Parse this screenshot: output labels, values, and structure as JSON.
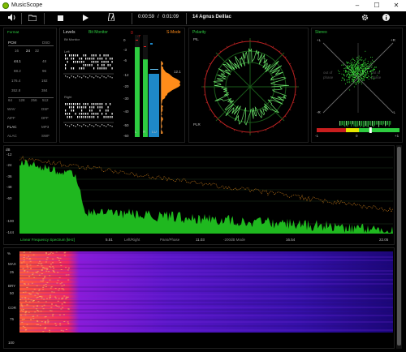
{
  "app": {
    "title": "MusicScope",
    "window_controls": [
      "–",
      "☐",
      "✕"
    ]
  },
  "toolbar": {
    "elapsed": "0:00:59",
    "total": "0:01:09",
    "track": "14 Agnus DeiIlac",
    "icons": [
      "volume-icon",
      "folder-icon",
      "stop-icon",
      "play-icon",
      "metronome-icon",
      "gear-icon",
      "info-icon"
    ]
  },
  "format": {
    "title": "Format",
    "formats": [
      {
        "label": "PCM",
        "selected": true
      },
      {
        "label": "DSD",
        "selected": false
      }
    ],
    "bitdepths": [
      "16",
      "24",
      "32"
    ],
    "bitdepth_selected": "24",
    "rates": [
      [
        "44.1",
        "48"
      ],
      [
        "88.2",
        "96"
      ],
      [
        "176.4",
        "192"
      ],
      [
        "352.8",
        "384"
      ]
    ],
    "rate_selected": "44.1",
    "bits_row": [
      "64",
      "128",
      "256",
      "512"
    ],
    "types": [
      [
        "WAV",
        "DSF"
      ],
      [
        "AIFF",
        "DFF"
      ],
      [
        "FLAC",
        "MP3"
      ],
      [
        "ALAC",
        "SWF"
      ]
    ],
    "type_selected": "FLAC"
  },
  "levels": {
    "title": "Levels",
    "bitmon": "Bit Monitor",
    "bitmon_label": "Bit Monitor",
    "left": "Left",
    "right": "Right",
    "scale": [
      "0",
      "-3",
      "-6",
      "-12",
      "-20",
      "-30",
      "-40",
      "-50",
      "-60"
    ],
    "peak_left": "-7",
    "peak_right": "-12",
    "smode": "S-Mode",
    "reading": "12.1",
    "lu": "LU",
    "ch": [
      "L",
      "R"
    ],
    "meter_left": 0.88,
    "meter_right": 0.76
  },
  "polar": {
    "title": "Polarity",
    "top": "PIL",
    "bottom": "PLR"
  },
  "stereo": {
    "title": "Stereo",
    "l_plus": "+L",
    "r_plus": "+R",
    "l_minus": "-L",
    "r_minus": "-R",
    "oop_left": "out of\nphase",
    "oop_right": "out of\nphase",
    "scale": [
      "-1",
      "0",
      "+1"
    ],
    "correlation": 0.3
  },
  "spectrum": {
    "db_label": "dB",
    "db_ticks": [
      "-12",
      "-24",
      "-36",
      "-48",
      "-60",
      "-100",
      "-144"
    ],
    "caption": "Linear Frequency Spectrum [kHz]",
    "freq_ticks": [
      "5.51",
      "11.03",
      "16.54",
      "22.05"
    ],
    "modes": [
      "Left/Right",
      "Pans/Phase",
      "-200dB Mode"
    ]
  },
  "spectrogram": {
    "pct_label": "%",
    "ticks": [
      "25",
      "50",
      "75",
      "100"
    ],
    "labels": [
      "MAX",
      "BRY",
      "COR"
    ]
  },
  "colors": {
    "accent": "#2ecc40",
    "spectrum": "#1fb81f",
    "trace": "#c87a1a",
    "bg": "#000000"
  }
}
